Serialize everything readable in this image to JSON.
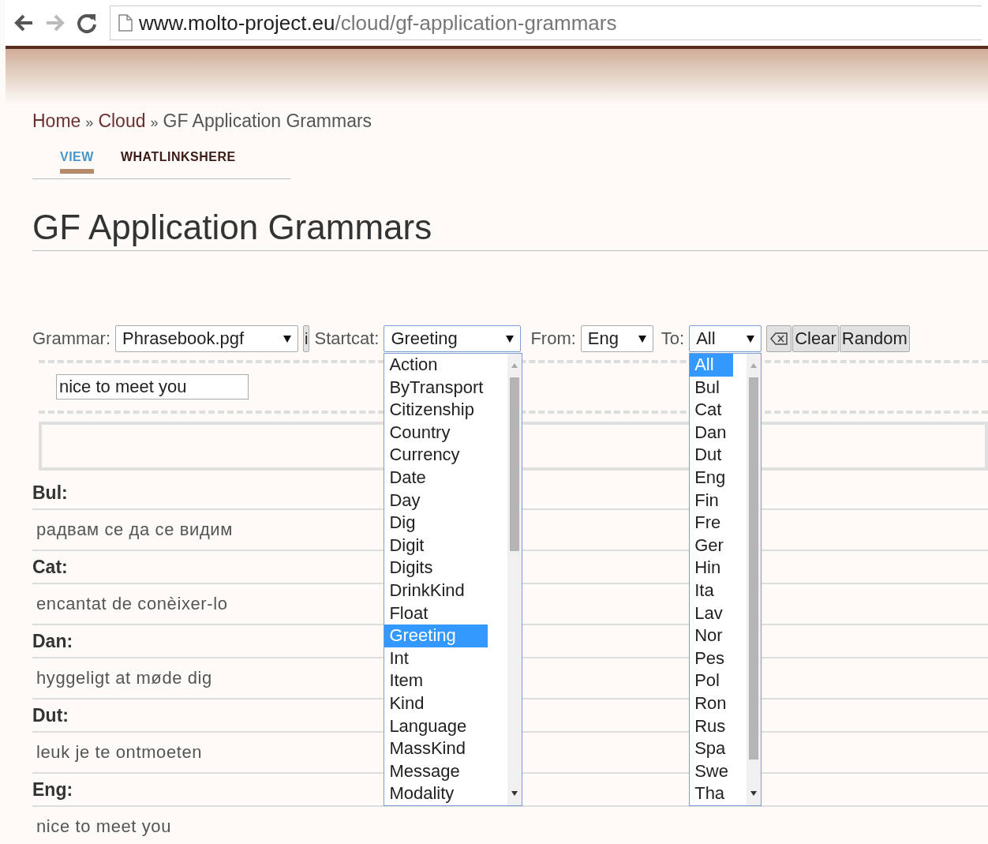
{
  "browser": {
    "back_disabled": false,
    "forward_disabled": true,
    "url": {
      "host": "www.molto-project.eu",
      "path": "/cloud/gf-application-grammars"
    }
  },
  "breadcrumb": [
    {
      "kind": "link",
      "text": "Home"
    },
    {
      "kind": "sep",
      "text": "»"
    },
    {
      "kind": "link",
      "text": "Cloud"
    },
    {
      "kind": "sep",
      "text": "»"
    },
    {
      "kind": "current",
      "text": "GF Application Grammars"
    }
  ],
  "tabs": [
    {
      "label": "VIEW",
      "selected": true
    },
    {
      "label": "WHATLINKSHERE",
      "selected": false
    }
  ],
  "title": "GF Application Grammars",
  "controls": {
    "grammar_label": "Grammar:",
    "grammar": "Phrasebook.pgf",
    "info_button": "i",
    "startcat_label": "Startcat:",
    "startcat": "Greeting",
    "from_label": "From:",
    "from": "Eng",
    "to_label": "To:",
    "to": "All",
    "clear_button": "Clear",
    "random_button": "Random"
  },
  "startcat_options": [
    {
      "label": "Action",
      "selected": false
    },
    {
      "label": "ByTransport",
      "selected": false
    },
    {
      "label": "Citizenship",
      "selected": false
    },
    {
      "label": "Country",
      "selected": false
    },
    {
      "label": "Currency",
      "selected": false
    },
    {
      "label": "Date",
      "selected": false
    },
    {
      "label": "Day",
      "selected": false
    },
    {
      "label": "Dig",
      "selected": false
    },
    {
      "label": "Digit",
      "selected": false
    },
    {
      "label": "Digits",
      "selected": false
    },
    {
      "label": "DrinkKind",
      "selected": false
    },
    {
      "label": "Float",
      "selected": false
    },
    {
      "label": "Greeting",
      "selected": true
    },
    {
      "label": "Int",
      "selected": false
    },
    {
      "label": "Item",
      "selected": false
    },
    {
      "label": "Kind",
      "selected": false
    },
    {
      "label": "Language",
      "selected": false
    },
    {
      "label": "MassKind",
      "selected": false
    },
    {
      "label": "Message",
      "selected": false
    },
    {
      "label": "Modality",
      "selected": false
    }
  ],
  "to_options": [
    {
      "label": "All",
      "selected": true
    },
    {
      "label": "Bul",
      "selected": false
    },
    {
      "label": "Cat",
      "selected": false
    },
    {
      "label": "Dan",
      "selected": false
    },
    {
      "label": "Dut",
      "selected": false
    },
    {
      "label": "Eng",
      "selected": false
    },
    {
      "label": "Fin",
      "selected": false
    },
    {
      "label": "Fre",
      "selected": false
    },
    {
      "label": "Ger",
      "selected": false
    },
    {
      "label": "Hin",
      "selected": false
    },
    {
      "label": "Ita",
      "selected": false
    },
    {
      "label": "Lav",
      "selected": false
    },
    {
      "label": "Nor",
      "selected": false
    },
    {
      "label": "Pes",
      "selected": false
    },
    {
      "label": "Pol",
      "selected": false
    },
    {
      "label": "Ron",
      "selected": false
    },
    {
      "label": "Rus",
      "selected": false
    },
    {
      "label": "Spa",
      "selected": false
    },
    {
      "label": "Swe",
      "selected": false
    },
    {
      "label": "Tha",
      "selected": false
    }
  ],
  "input": {
    "value": "nice to meet you"
  },
  "translations": [
    {
      "language": "Bul:",
      "text": "радвам се да се видим"
    },
    {
      "language": "Cat:",
      "text": "encantat de conèixer-lo"
    },
    {
      "language": "Dan:",
      "text": "hyggeligt at møde dig"
    },
    {
      "language": "Dut:",
      "text": "leuk je te ontmoeten"
    },
    {
      "language": "Eng:",
      "text": "nice to meet you"
    }
  ]
}
